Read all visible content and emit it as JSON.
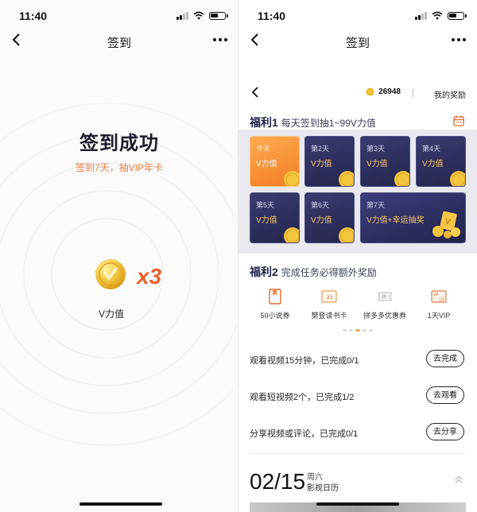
{
  "left": {
    "status_time": "11:40",
    "nav_title": "签到",
    "success_title": "签到成功",
    "success_sub": "签到7天，抽VIP年卡",
    "reward_mult": "x3",
    "reward_label": "V力值"
  },
  "right": {
    "status_time": "11:40",
    "nav_title": "签到",
    "balance": "26948",
    "my_rewards": "我的奖励",
    "section1": {
      "badge": "福利1",
      "text": "每天签到抽1~99V力值"
    },
    "days": [
      {
        "label": "今天",
        "value": "V力值"
      },
      {
        "label": "第2天",
        "value": "V力值"
      },
      {
        "label": "第3天",
        "value": "V力值"
      },
      {
        "label": "第4天",
        "value": "V力值"
      },
      {
        "label": "第5天",
        "value": "V力值"
      },
      {
        "label": "第6天",
        "value": "V力值"
      },
      {
        "label": "第7天",
        "value": "V力值+幸运抽奖"
      }
    ],
    "section2": {
      "badge": "福利2",
      "text": "完成任务必得额外奖励"
    },
    "coupons": [
      {
        "label": "50小说券"
      },
      {
        "label": "樊登读书卡"
      },
      {
        "label": "拼多多优惠券"
      },
      {
        "label": "1天VIP"
      }
    ],
    "tasks": [
      {
        "text": "观看视频15分钟，已完成0/1",
        "button": "去完成"
      },
      {
        "text": "观看短视频2个，已完成1/2",
        "button": "去观看"
      },
      {
        "text": "分享视频或评论，已完成0/1",
        "button": "去分享"
      }
    ],
    "date": "02/15",
    "weekday": "周六",
    "calendar_label": "影视日历"
  },
  "colors": {
    "accent_orange": "#ee7a3d",
    "card_navy": "#2b2c5a",
    "coin_gold": "#f2c53d"
  },
  "icons": [
    "chevron-left-icon",
    "more-icon",
    "coin-icon",
    "calendar-icon",
    "book-icon",
    "card-icon",
    "coupon-icon",
    "vip-ticket-icon",
    "chevron-up-icon",
    "wifi-icon",
    "signal-icon",
    "battery-icon"
  ]
}
